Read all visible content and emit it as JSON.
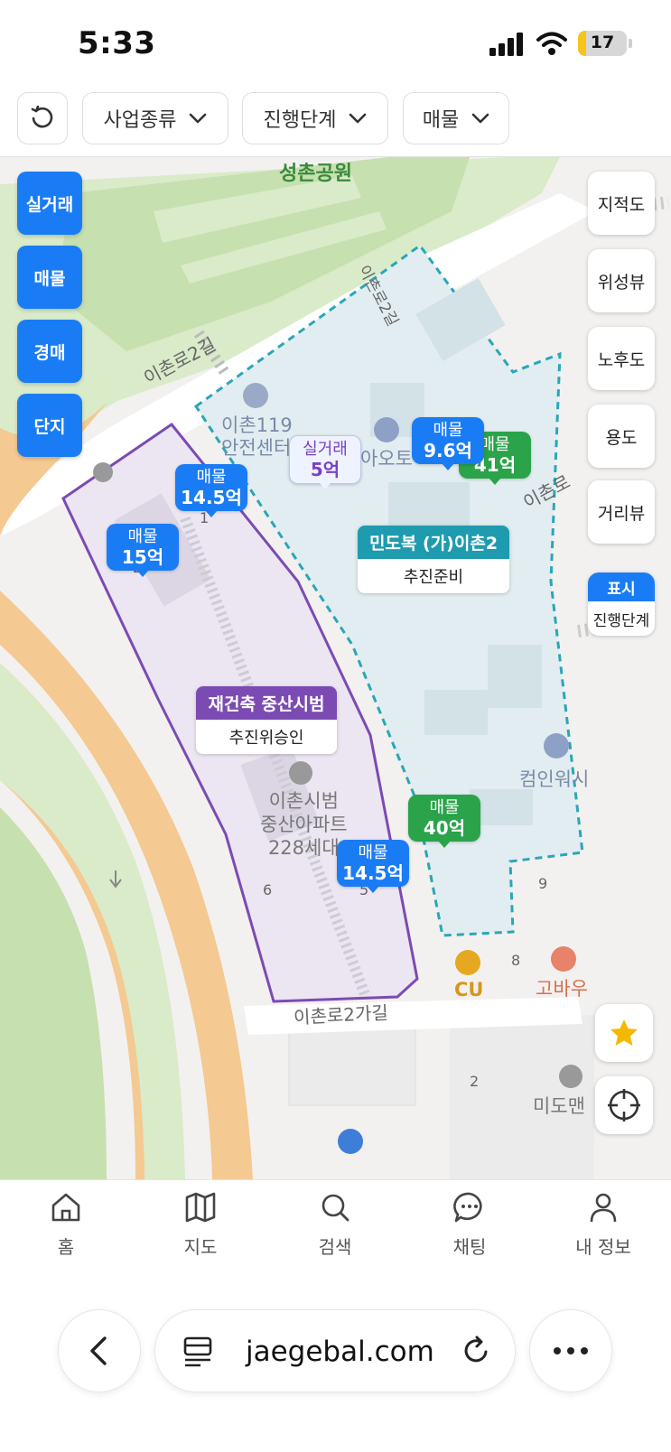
{
  "status_bar": {
    "time": "5:33",
    "battery": "17",
    "battery_level": 0.17
  },
  "filters": {
    "reset_icon": "refresh-icon",
    "business_type": "사업종류",
    "progress_stage": "진행단계",
    "listing": "매물"
  },
  "map": {
    "labels": {
      "park": "성촌공원",
      "road_ichon2gil_a": "이촌로2길",
      "road_ichon2gil_b": "이촌로2길",
      "road_ichonro": "이촌로",
      "road_ichon2gagil": "이촌로2가길",
      "poi_119_line1": "이촌119",
      "poi_119_line2": "안전센터",
      "poi_auto": "아오토",
      "poi_carwash": "컴인워시",
      "poi_cu": "CU",
      "poi_gobau": "고바우",
      "poi_apt_line1": "이촌시범",
      "poi_apt_line2": "중산아파트",
      "poi_apt_line3": "228세대",
      "poi_mido": "미도맨",
      "num_1": "1",
      "num_2": "2",
      "num_5": "5",
      "num_6": "6",
      "num_8": "8",
      "num_9": "9",
      "num_2b": "2"
    },
    "layers": [
      "실거래",
      "매물",
      "경매",
      "단지"
    ],
    "controls": {
      "cadastral": "지적도",
      "satellite": "위성뷰",
      "aging": "노후도",
      "zoning": "용도",
      "street": "거리뷰",
      "toggle_state": "표시",
      "toggle_label": "진행단계"
    },
    "markers": [
      {
        "type": "매물",
        "price": "14.5억"
      },
      {
        "type": "매물",
        "price": "15억"
      },
      {
        "type": "실거래",
        "price": "5억"
      },
      {
        "type": "매물",
        "price": "9.6억"
      },
      {
        "type": "매물",
        "price": "41억"
      },
      {
        "type": "매물",
        "price": "40억"
      },
      {
        "type": "매물",
        "price": "14.5억"
      }
    ],
    "projects": [
      {
        "title": "민도복 (가)이촌2",
        "stage": "추진준비",
        "color": "#1f9bb0"
      },
      {
        "title": "재건축 중산시범",
        "stage": "추진위승인",
        "color": "#7b4bb3"
      }
    ]
  },
  "nav": [
    "홈",
    "지도",
    "검색",
    "채팅",
    "내 정보"
  ],
  "browser": {
    "url": "jaegebal.com"
  },
  "colors": {
    "accent": "#1a7cf5",
    "green_marker": "#2aa34a",
    "teal_zone": "#2aa6b8",
    "purple_zone": "#7b4bb3"
  }
}
